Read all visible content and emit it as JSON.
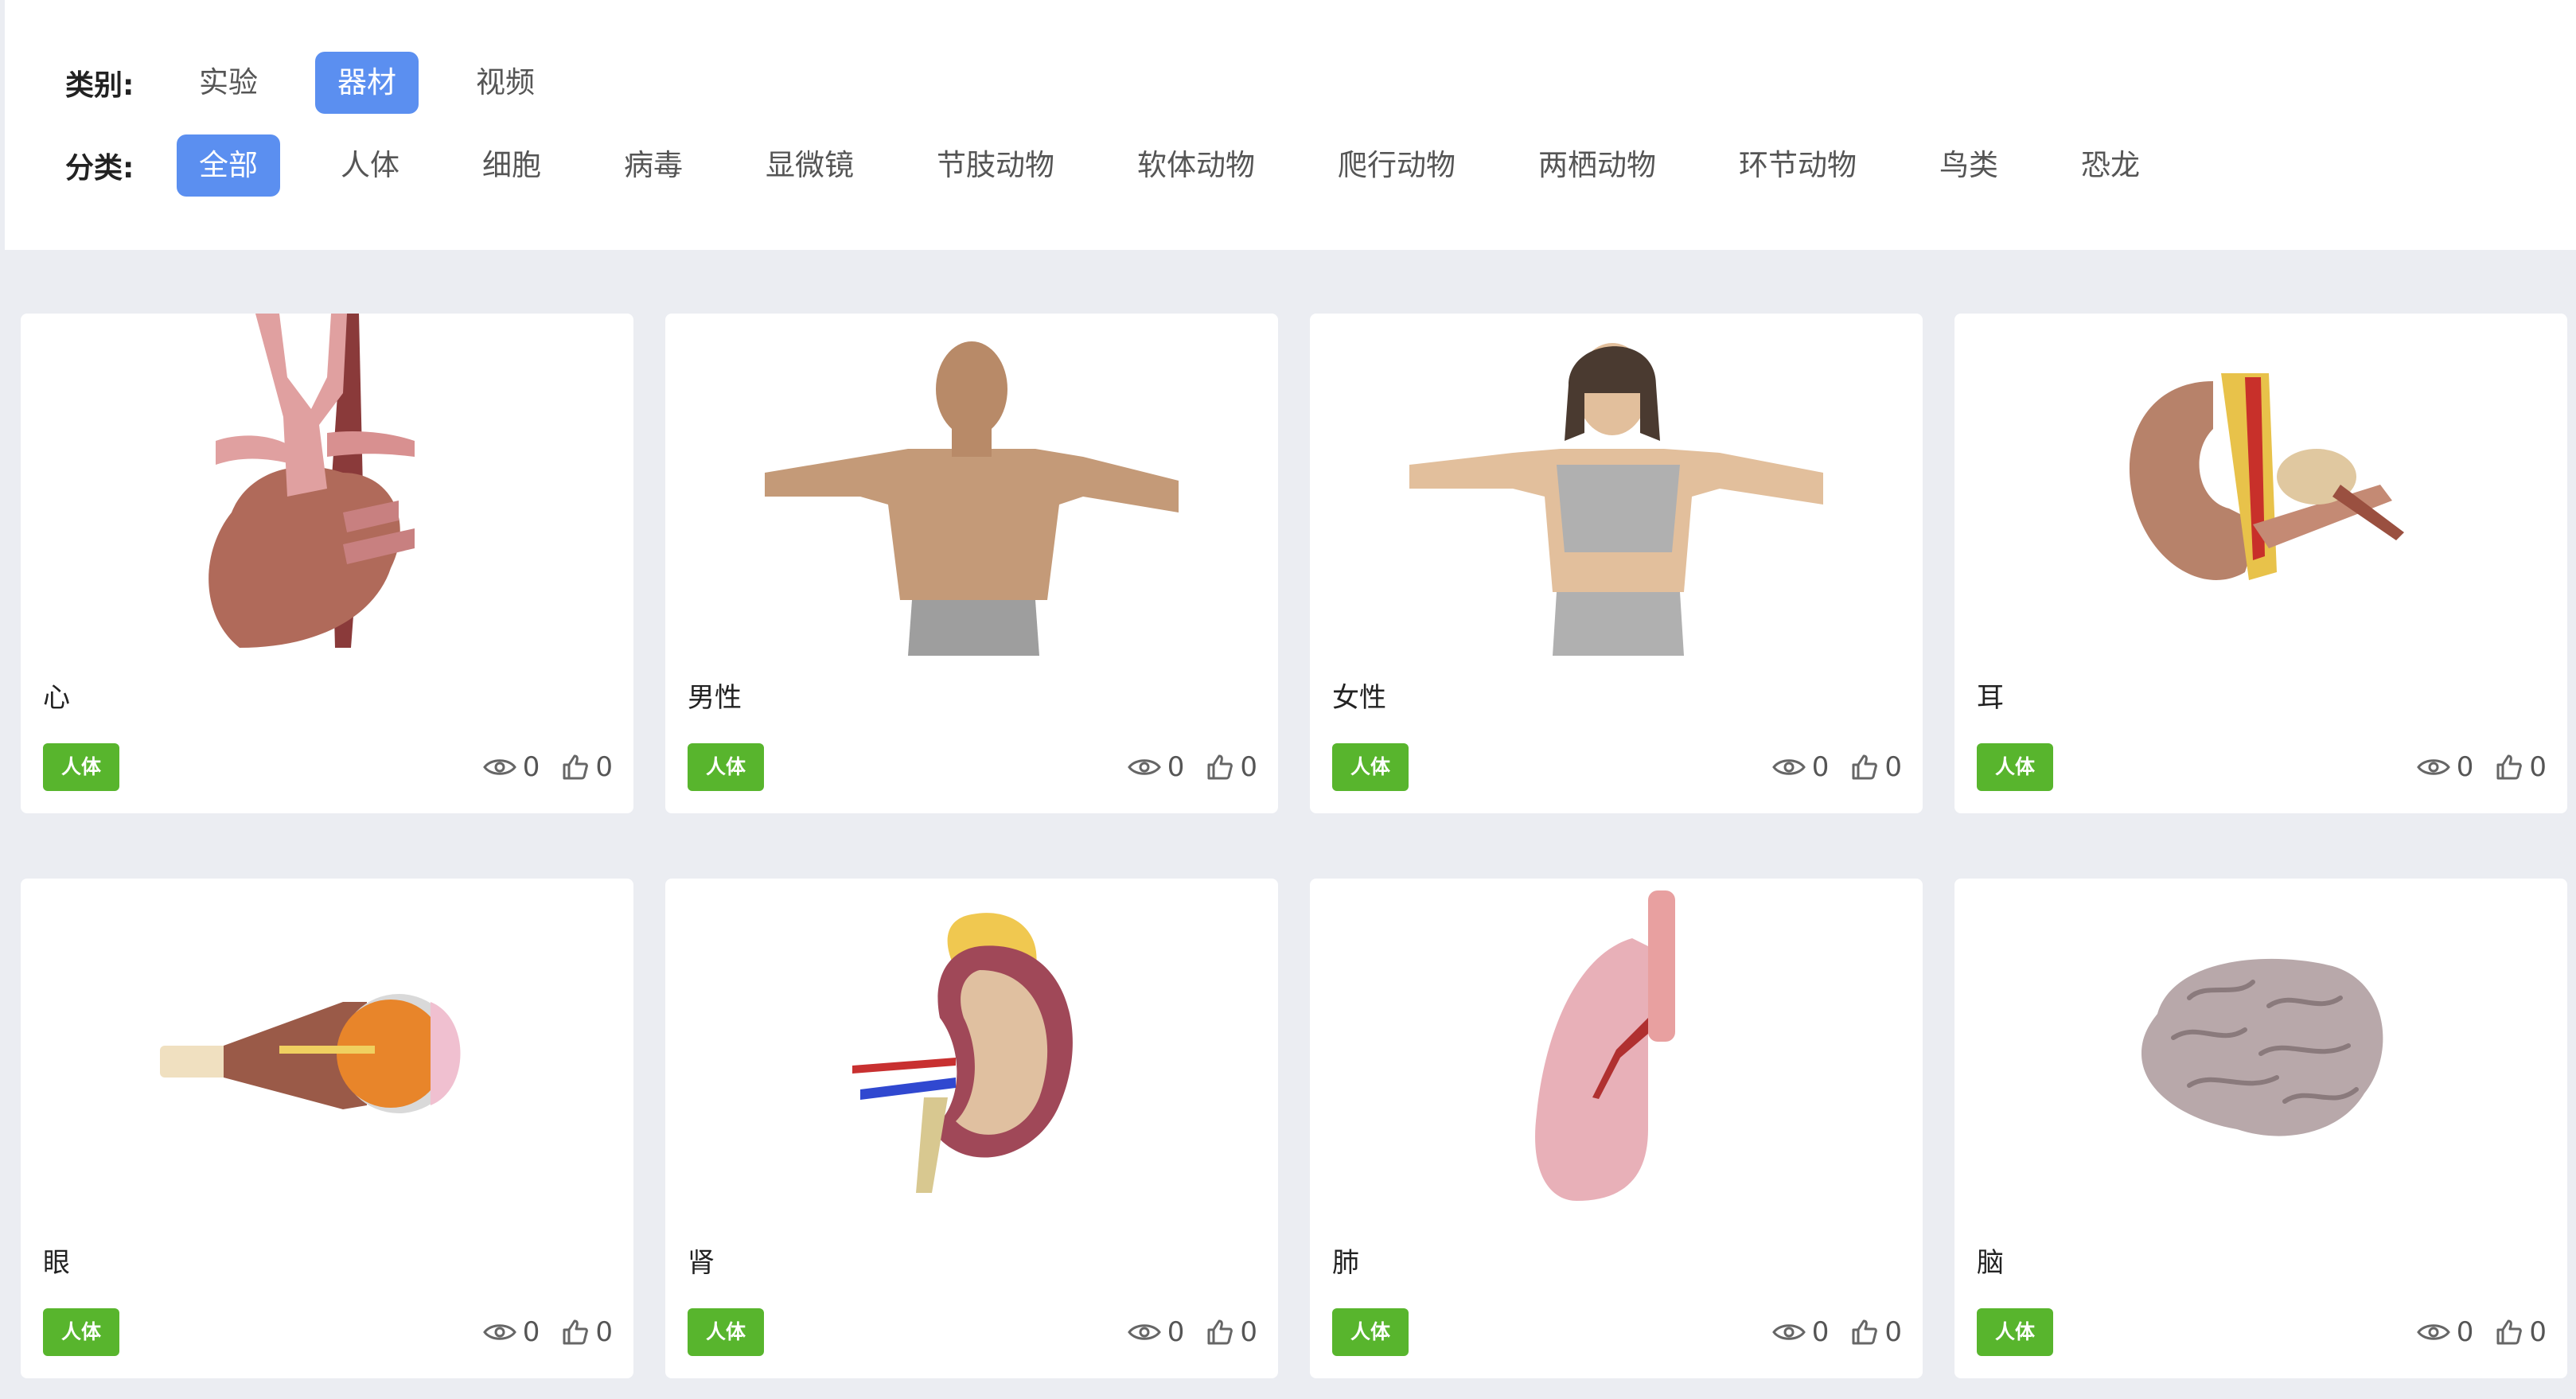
{
  "filters": {
    "type_label": "类别:",
    "type_options": [
      "实验",
      "器材",
      "视频"
    ],
    "type_active": "器材",
    "category_label": "分类:",
    "category_options": [
      "全部",
      "人体",
      "细胞",
      "病毒",
      "显微镜",
      "节肢动物",
      "软体动物",
      "爬行动物",
      "两栖动物",
      "环节动物",
      "鸟类",
      "恐龙"
    ],
    "category_active": "全部",
    "active_color": "#5b8ff0"
  },
  "cards": [
    {
      "title": "心",
      "tag": "人体",
      "views": "0",
      "likes": "0",
      "model": "heart"
    },
    {
      "title": "男性",
      "tag": "人体",
      "views": "0",
      "likes": "0",
      "model": "male"
    },
    {
      "title": "女性",
      "tag": "人体",
      "views": "0",
      "likes": "0",
      "model": "female"
    },
    {
      "title": "耳",
      "tag": "人体",
      "views": "0",
      "likes": "0",
      "model": "ear"
    },
    {
      "title": "眼",
      "tag": "人体",
      "views": "0",
      "likes": "0",
      "model": "eye"
    },
    {
      "title": "肾",
      "tag": "人体",
      "views": "0",
      "likes": "0",
      "model": "kidney"
    },
    {
      "title": "肺",
      "tag": "人体",
      "views": "0",
      "likes": "0",
      "model": "lung"
    },
    {
      "title": "脑",
      "tag": "人体",
      "views": "0",
      "likes": "0",
      "model": "brain"
    }
  ],
  "icons": {
    "views": "eye-icon",
    "likes": "thumbs-up-icon"
  },
  "tag_color": "#58b52d"
}
